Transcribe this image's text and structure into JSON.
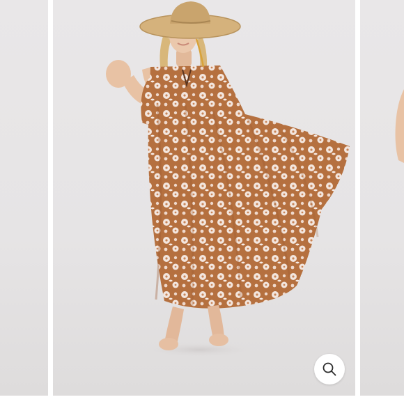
{
  "gallery": {
    "zoom_button": {
      "icon": "magnifier-icon",
      "label": ""
    },
    "slides": [
      {
        "role": "previous",
        "subject": "model-photo-partial"
      },
      {
        "role": "current",
        "subject": "model-photo-floral-dress-straw-hat"
      },
      {
        "role": "next",
        "subject": "model-photo-partial-arm"
      }
    ],
    "colors": {
      "backdrop": "#e7e5e6",
      "dress_rust": "#b5703f",
      "dress_print": "#f3e6de",
      "hat_straw": "#d5b27c",
      "skin": "#e8c2a4",
      "zoom_button_bg": "#ffffff",
      "zoom_icon": "#2b2b2b"
    }
  }
}
